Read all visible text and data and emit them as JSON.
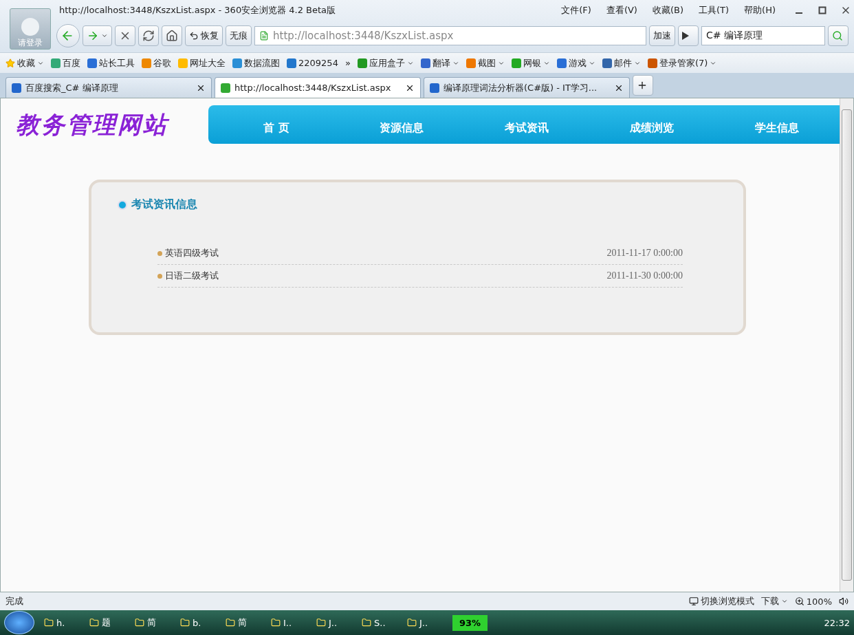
{
  "window": {
    "title": "http://localhost:3448/KszxList.aspx - 360安全浏览器 4.2 Beta版",
    "login": "请登录"
  },
  "menu": [
    "文件(F)",
    "查看(V)",
    "收藏(B)",
    "工具(T)",
    "帮助(H)"
  ],
  "toolbar": {
    "restore": "恢复",
    "private": "无痕",
    "address": "http://localhost:3448/KszxList.aspx",
    "speedup": "加速",
    "search": "C# 编译原理"
  },
  "bookmarks": [
    {
      "label": "收藏",
      "dropdown": true
    },
    {
      "label": "百度",
      "dropdown": false
    },
    {
      "label": "站长工具",
      "dropdown": false
    },
    {
      "label": "谷歌",
      "dropdown": false
    },
    {
      "label": "网址大全",
      "dropdown": false
    },
    {
      "label": "数据流图",
      "dropdown": false
    },
    {
      "label": "2209254",
      "dropdown": false
    },
    {
      "label": "»",
      "dropdown": false
    },
    {
      "label": "应用盒子",
      "dropdown": true
    },
    {
      "label": "翻译",
      "dropdown": true
    },
    {
      "label": "截图",
      "dropdown": true
    },
    {
      "label": "网银",
      "dropdown": true
    },
    {
      "label": "游戏",
      "dropdown": true
    },
    {
      "label": "邮件",
      "dropdown": true
    },
    {
      "label": "登录管家(7)",
      "dropdown": true
    }
  ],
  "tabs": [
    {
      "label": "百度搜索_C# 编译原理",
      "selected": false
    },
    {
      "label": "http://localhost:3448/KszxList.aspx",
      "selected": true
    },
    {
      "label": "编译原理词法分析器(C#版) - IT学习...",
      "selected": false
    }
  ],
  "page": {
    "logo": "教务管理网站",
    "nav": [
      "首 页",
      "资源信息",
      "考试资讯",
      "成绩浏览",
      "学生信息"
    ],
    "panel_title": "考试资讯信息",
    "items": [
      {
        "title": "英语四级考试",
        "date": "2011-11-17 0:00:00"
      },
      {
        "title": "日语二级考试",
        "date": "2011-11-30 0:00:00"
      }
    ]
  },
  "status_bar": {
    "text": "完成",
    "mode": "切换浏览模式",
    "download": "下载",
    "zoom": "100%"
  },
  "taskbar": {
    "items": [
      "h.",
      "题",
      "简",
      "b.",
      "简",
      "I..",
      "J..",
      "S..",
      "J.."
    ],
    "battery": "93%",
    "clock": "22:32"
  }
}
